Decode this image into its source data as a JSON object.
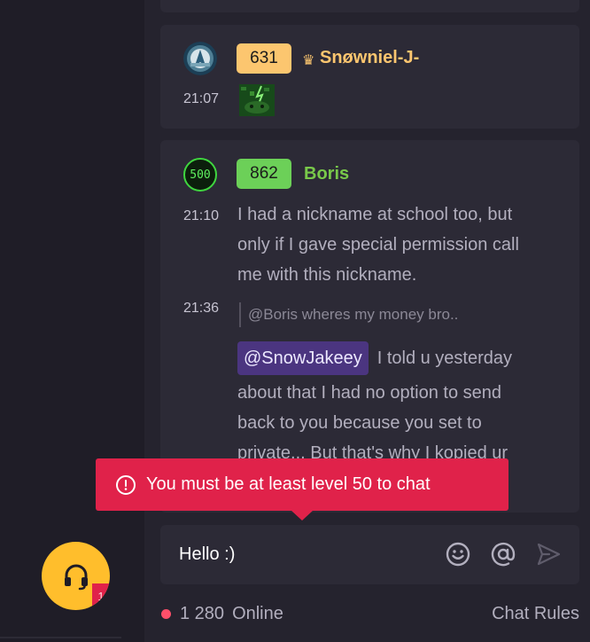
{
  "colors": {
    "accent_yellow": "#ffbe2c",
    "level_badge_gold": "#fcc66f",
    "level_badge_green": "#6cd058",
    "username_gold": "#fcc66f",
    "username_green": "#79c94a",
    "error_red": "#e0224a",
    "mention_purple": "#4b3580",
    "online_dot": "#ff4f6a"
  },
  "messages": [
    {
      "level": "631",
      "crown": "♛",
      "username": "Snøwniel-J-",
      "time": "21:07"
    },
    {
      "avatar_text": "500",
      "level": "862",
      "username": "Boris",
      "time": "21:10",
      "lines": [
        "I had a nickname at school too, but",
        "only if I gave special permission call",
        "me with this nickname."
      ],
      "reply": {
        "time": "21:36",
        "quote": "@Boris wheres my money bro..",
        "mention": "@SnowJakeey",
        "first_line": "I told u yesterday",
        "lines": [
          "about that I had no option to send",
          "back to you because you set to",
          "private... But that's why I kopied ur"
        ]
      }
    }
  ],
  "error_toast": {
    "text": "You must be at least level 50 to chat",
    "icon": "alert-circle-icon"
  },
  "chat_input": {
    "value": "Hello :)"
  },
  "icons": {
    "emoji": "smile-icon",
    "mention": "at-icon",
    "send": "send-icon",
    "support": "headset-icon"
  },
  "footer": {
    "online_count": "1 280",
    "online_label": "Online",
    "rules_label": "Chat Rules"
  },
  "support_badge": "1"
}
